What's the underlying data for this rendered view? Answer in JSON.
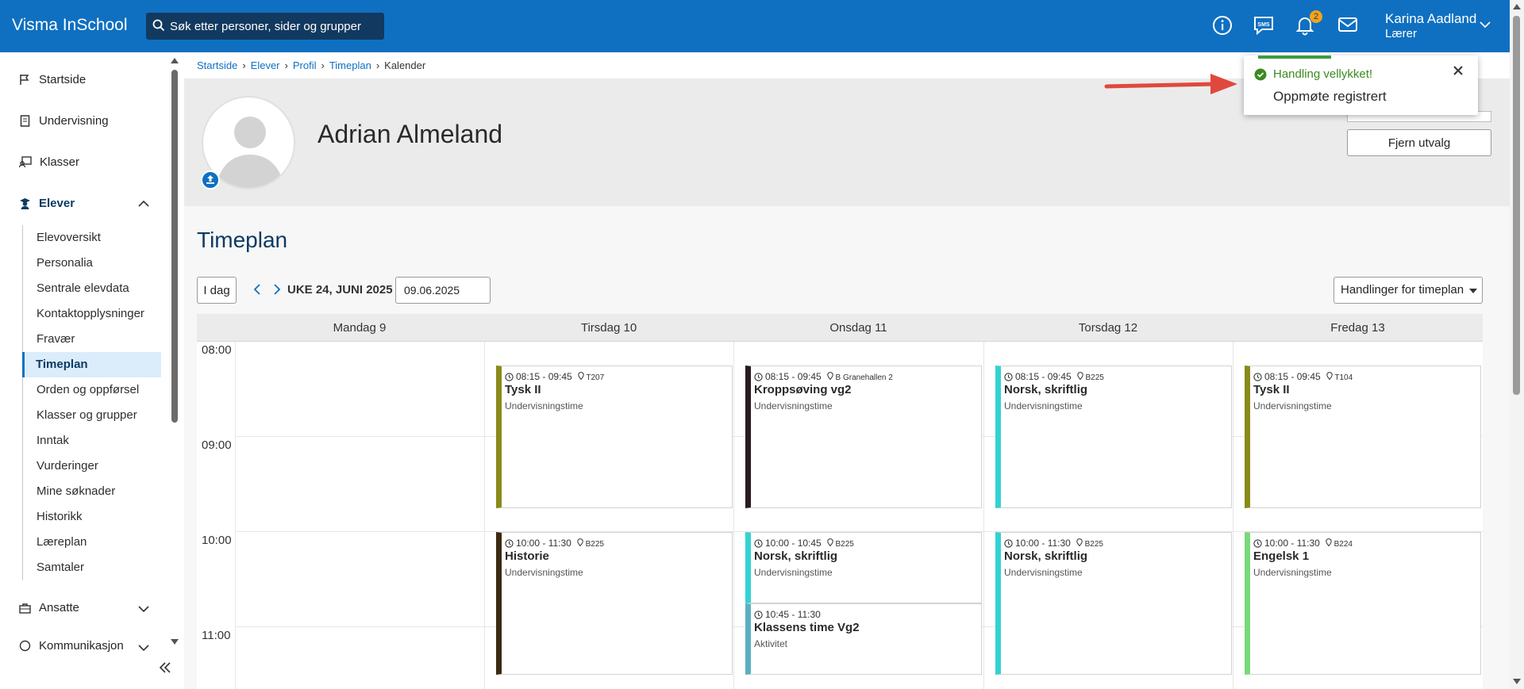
{
  "app": {
    "title": "Visma InSchool"
  },
  "search": {
    "placeholder": "Søk etter personer, sider og grupper"
  },
  "header": {
    "badge_count": "2",
    "user_name": "Karina Aadland",
    "user_role": "Lærer"
  },
  "sidebar": {
    "items": [
      {
        "label": "Startside",
        "icon": "flag-icon"
      },
      {
        "label": "Undervisning",
        "icon": "book-icon"
      },
      {
        "label": "Klasser",
        "icon": "classes-icon"
      },
      {
        "label": "Elever",
        "icon": "student-icon"
      }
    ],
    "sub_items": [
      "Elevoversikt",
      "Personalia",
      "Sentrale elevdata",
      "Kontaktopplysninger",
      "Fravær",
      "Timeplan",
      "Orden og oppførsel",
      "Klasser og grupper",
      "Inntak",
      "Vurderinger",
      "Mine søknader",
      "Historikk",
      "Læreplan",
      "Samtaler"
    ],
    "bottom_items": [
      {
        "label": "Ansatte",
        "icon": "briefcase-icon"
      },
      {
        "label": "Kommunikasjon",
        "icon": "chat-icon"
      }
    ]
  },
  "breadcrumb": [
    "Startside",
    "Elever",
    "Profil",
    "Timeplan",
    "Kalender"
  ],
  "profile": {
    "name": "Adrian Almeland",
    "remove_selection": "Fjern utvalg"
  },
  "timetable": {
    "title": "Timeplan",
    "today_button": "I dag",
    "week_label": "UKE 24, JUNI 2025",
    "date_value": "09.06.2025",
    "actions_button": "Handlinger for timeplan",
    "days": [
      "Mandag 9",
      "Tirsdag 10",
      "Onsdag 11",
      "Torsdag 12",
      "Fredag 13"
    ],
    "hours": [
      "08:00",
      "09:00",
      "10:00",
      "11:00"
    ],
    "events": [
      {
        "day": 1,
        "start": "08:15",
        "end": "09:45",
        "time": "08:15 - 09:45",
        "room": "T207",
        "title": "Tysk II",
        "sub": "Undervisningstime",
        "color": "#8a8a1a"
      },
      {
        "day": 2,
        "start": "08:15",
        "end": "09:45",
        "time": "08:15 - 09:45",
        "room": "B Granehallen 2",
        "title": "Kroppsøving vg2",
        "sub": "Undervisningstime",
        "color": "#2a1a22"
      },
      {
        "day": 3,
        "start": "08:15",
        "end": "09:45",
        "time": "08:15 - 09:45",
        "room": "B225",
        "title": "Norsk, skriftlig",
        "sub": "Undervisningstime",
        "color": "#33d2d2"
      },
      {
        "day": 4,
        "start": "08:15",
        "end": "09:45",
        "time": "08:15 - 09:45",
        "room": "T104",
        "title": "Tysk II",
        "sub": "Undervisningstime",
        "color": "#8a8a1a"
      },
      {
        "day": 1,
        "start": "10:00",
        "end": "11:30",
        "time": "10:00 - 11:30",
        "room": "B225",
        "title": "Historie",
        "sub": "Undervisningstime",
        "color": "#3a2a12"
      },
      {
        "day": 2,
        "start": "10:00",
        "end": "10:45",
        "time": "10:00 - 10:45",
        "room": "B225",
        "title": "Norsk, skriftlig",
        "sub": "Undervisningstime",
        "color": "#33d2d2"
      },
      {
        "day": 2,
        "start": "10:45",
        "end": "11:30",
        "time": "10:45 - 11:30",
        "room": "",
        "title": "Klassens time Vg2",
        "sub": "Aktivitet",
        "color": "#5ab0c0"
      },
      {
        "day": 3,
        "start": "10:00",
        "end": "11:30",
        "time": "10:00 - 11:30",
        "room": "B225",
        "title": "Norsk, skriftlig",
        "sub": "Undervisningstime",
        "color": "#33d2d2"
      },
      {
        "day": 4,
        "start": "10:00",
        "end": "11:30",
        "time": "10:00 - 11:30",
        "room": "B224",
        "title": "Engelsk 1",
        "sub": "Undervisningstime",
        "color": "#7ad87a"
      }
    ]
  },
  "toast": {
    "title": "Handling vellykket!",
    "message": "Oppmøte registrert",
    "arrow_color": "#e0483e"
  },
  "colors": {
    "brand": "#0f70c1",
    "accent_dark": "#0d3a63",
    "success": "#3a8a1f",
    "badge": "#f2a31b"
  }
}
